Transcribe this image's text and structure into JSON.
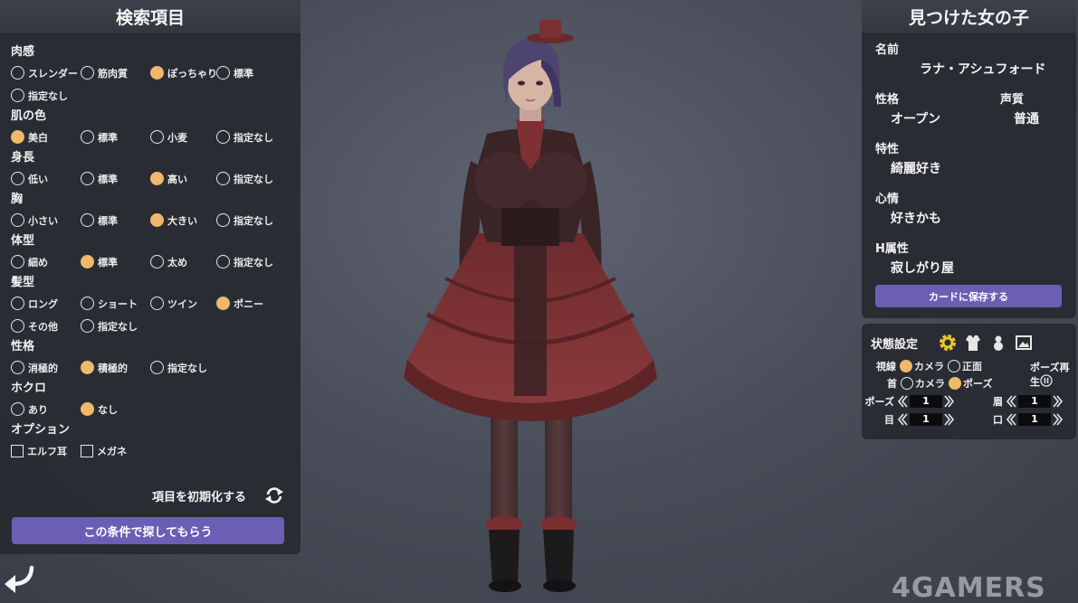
{
  "search": {
    "title": "検索項目",
    "groups": [
      {
        "label": "肉感",
        "rows": [
          [
            "スレンダー",
            "筋肉質",
            "ぽっちゃり",
            "標準"
          ],
          [
            "指定なし"
          ]
        ],
        "selected": "ぽっちゃり"
      },
      {
        "label": "肌の色",
        "rows": [
          [
            "美白",
            "標準",
            "小麦",
            "指定なし"
          ]
        ],
        "selected": "美白"
      },
      {
        "label": "身長",
        "rows": [
          [
            "低い",
            "標準",
            "高い",
            "指定なし"
          ]
        ],
        "selected": "高い"
      },
      {
        "label": "胸",
        "rows": [
          [
            "小さい",
            "標準",
            "大きい",
            "指定なし"
          ]
        ],
        "selected": "大きい"
      },
      {
        "label": "体型",
        "rows": [
          [
            "細め",
            "標準",
            "太め",
            "指定なし"
          ]
        ],
        "selected": "標準"
      },
      {
        "label": "髪型",
        "rows": [
          [
            "ロング",
            "ショート",
            "ツイン",
            "ポニー"
          ],
          [
            "その他",
            "指定なし"
          ]
        ],
        "selected": "ポニー"
      },
      {
        "label": "性格",
        "rows": [
          [
            "消極的",
            "積極的",
            "指定なし"
          ]
        ],
        "selected": "積極的"
      },
      {
        "label": "ホクロ",
        "rows": [
          [
            "あり",
            "なし"
          ]
        ],
        "selected": "なし"
      }
    ],
    "options": {
      "label": "オプション",
      "items": [
        "エルフ耳",
        "メガネ"
      ],
      "checked": []
    },
    "reset_label": "項目を初期化する",
    "submit_label": "この条件で探してもらう"
  },
  "found": {
    "title": "見つけた女の子",
    "name_label": "名前",
    "name_value": "ラナ・アシュフォード",
    "personality_label": "性格",
    "personality_value": "オープン",
    "voice_label": "声質",
    "voice_value": "普通",
    "trait_label": "特性",
    "trait_value": "綺麗好き",
    "mood_label": "心情",
    "mood_value": "好きかも",
    "h_attr_label": "H属性",
    "h_attr_value": "寂しがり屋",
    "save_label": "カードに保存する"
  },
  "state": {
    "title": "状態設定",
    "icons": [
      "gear-icon",
      "outfit-icon",
      "accessory-icon",
      "image-icon"
    ],
    "gaze": {
      "label": "視線",
      "options": [
        "カメラ",
        "正面"
      ],
      "selected": "カメラ"
    },
    "neck": {
      "label": "首",
      "options": [
        "カメラ",
        "ポーズ"
      ],
      "selected": "ポーズ"
    },
    "pose_play_label": "ポーズ再生",
    "steppers": {
      "pose": {
        "label": "ポーズ",
        "value": "1"
      },
      "brow": {
        "label": "眉",
        "value": "1"
      },
      "eye": {
        "label": "目",
        "value": "1"
      },
      "mouth": {
        "label": "口",
        "value": "1"
      }
    }
  },
  "colors": {
    "accent": "#6a5fb4",
    "selected_radio": "#f0b86a",
    "panel": "#2a2c34"
  },
  "watermark": "4GAMERS"
}
